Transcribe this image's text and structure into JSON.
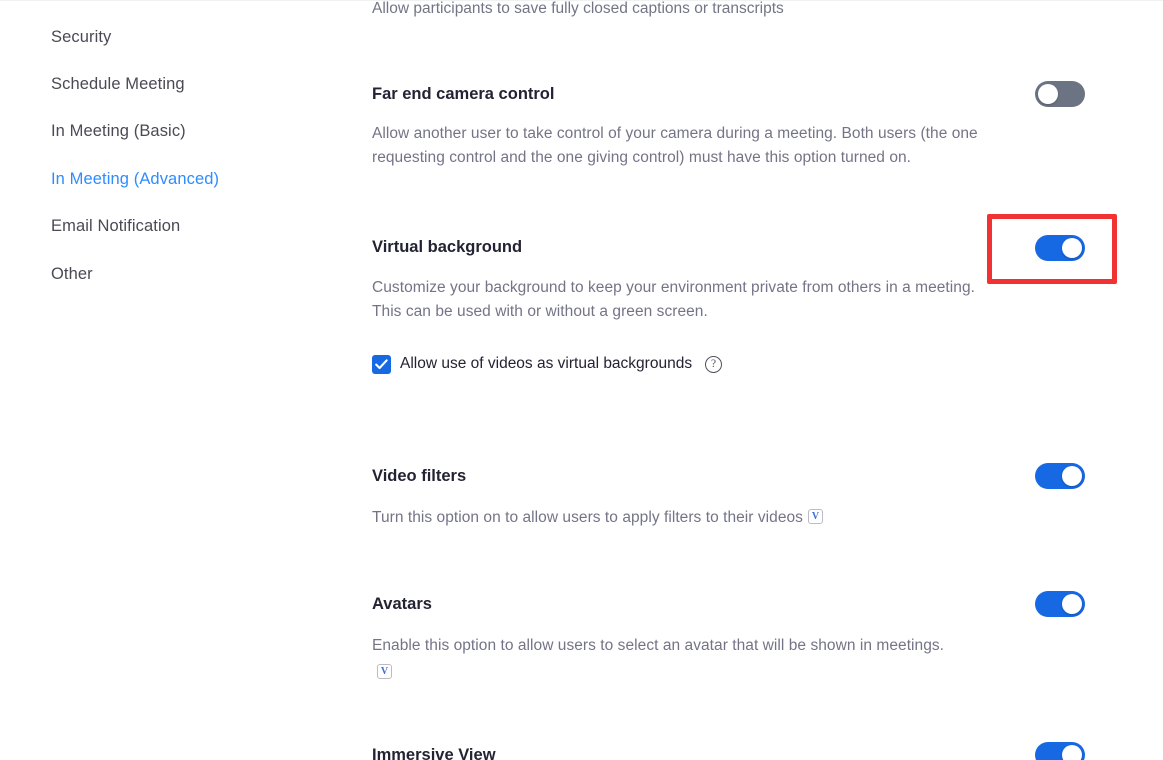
{
  "colors": {
    "accent_blue": "#2d8cff",
    "toggle_on": "#1668e3",
    "toggle_off": "#6c7383",
    "highlight_red": "#f03232",
    "heading_text": "#232333",
    "body_text": "#747487",
    "nav_text": "#4a4a55"
  },
  "sidebar": {
    "items": [
      {
        "label": "Security",
        "active": false
      },
      {
        "label": "Schedule Meeting",
        "active": false
      },
      {
        "label": "In Meeting (Basic)",
        "active": false
      },
      {
        "label": "In Meeting (Advanced)",
        "active": true
      },
      {
        "label": "Email Notification",
        "active": false
      },
      {
        "label": "Other",
        "active": false
      }
    ]
  },
  "main": {
    "truncated_top_line": "Allow participants to save fully closed captions or transcripts",
    "sections": [
      {
        "title": "Far end camera control",
        "description": "Allow another user to take control of your camera during a meeting. Both users (the one requesting control and the one giving control) must have this option turned on.",
        "toggle_state": "off",
        "highlighted": false
      },
      {
        "title": "Virtual background",
        "description": "Customize your background to keep your environment private from others in a meeting. This can be used with or without a green screen.",
        "toggle_state": "on",
        "highlighted": true,
        "checkbox": {
          "label": "Allow use of videos as virtual backgrounds",
          "checked": true,
          "help_icon": "?"
        }
      },
      {
        "title": "Video filters",
        "description": "Turn this option on to allow users to apply filters to their videos",
        "badge": "V",
        "toggle_state": "on",
        "highlighted": false
      },
      {
        "title": "Avatars",
        "description": "Enable this option to allow users to select an avatar that will be shown in meetings.",
        "badge": "V",
        "toggle_state": "on",
        "highlighted": false
      },
      {
        "title": "Immersive View",
        "description": "",
        "toggle_state": "on",
        "highlighted": false
      }
    ]
  }
}
